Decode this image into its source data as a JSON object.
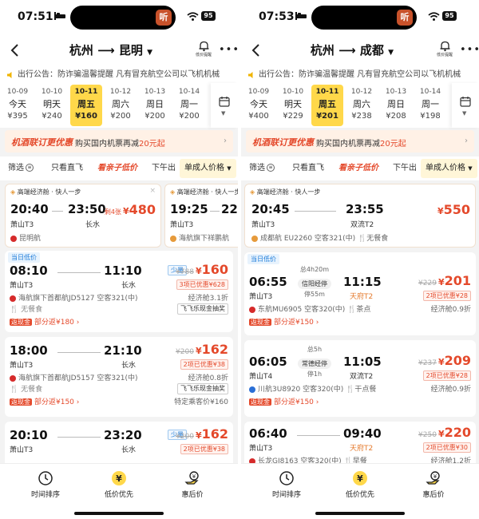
{
  "screens": [
    {
      "status_time": "07:51",
      "battery": "95",
      "from_city": "杭州",
      "to_city": "昆明",
      "bell_label": "低价提醒",
      "notice": "出行公告：防诈骗温馨提醒  凡有冒充航空公司以飞机机械",
      "dates": [
        {
          "date": "10-09",
          "weekday": "今天",
          "price": "¥395"
        },
        {
          "date": "10-10",
          "weekday": "明天",
          "price": "¥240"
        },
        {
          "date": "10-11",
          "weekday": "周五",
          "price": "¥160"
        },
        {
          "date": "10-12",
          "weekday": "周六",
          "price": "¥200"
        },
        {
          "date": "10-13",
          "weekday": "周日",
          "price": "¥200"
        },
        {
          "date": "10-14",
          "weekday": "周一",
          "price": "¥200"
        }
      ],
      "promo": {
        "title": "机酒联订更优惠",
        "text": "购买国内机票再减",
        "amount": "20元起"
      },
      "filters": {
        "f1": "筛选",
        "f2": "只看直飞",
        "f3": "看亲子低价",
        "f4": "下午出",
        "select": "单成人价格"
      },
      "highlight_badge": "高端经济舱 · 快人一步",
      "highlight_flights": [
        {
          "dep_time": "20:40",
          "arr_time": "23:50",
          "dep_ap": "萧山T3",
          "arr_ap": "长水",
          "remain": "剩4张",
          "price": "480",
          "airline": "昆明航"
        },
        {
          "dep_time": "19:25",
          "arr_time": "22:",
          "dep_ap": "萧山T3",
          "airline": "海航旗下祥鹏航"
        }
      ],
      "flights": [
        {
          "badge": "当日低价",
          "dep_time": "08:10",
          "arr_time": "11:10",
          "dep_ap": "萧山T3",
          "arr_ap": "长水",
          "tag": "少量",
          "orig_price": "¥788",
          "price": "160",
          "coupon": "3项已优惠¥628",
          "airline": "海航旗下首都航JD5127  空客321(中)",
          "cabin": "经济舱3.1折",
          "meal": "无餐食",
          "cash_tag": "飞飞乐现金抽奖",
          "rebate_box": "返现金",
          "rebate": "部分返¥180"
        },
        {
          "dep_time": "18:00",
          "arr_time": "21:10",
          "dep_ap": "萧山T3",
          "arr_ap": "长水",
          "orig_price": "¥200",
          "price": "162",
          "coupon": "2项已优惠¥38",
          "airline": "海航旗下首都航JD5157  空客321(中)",
          "cabin": "经济舱0.8折",
          "meal": "无餐食",
          "cash_tag": "飞飞乐现金抽奖",
          "note": "特定乘客价¥160",
          "rebate_box": "返现金",
          "rebate": "部分返¥150"
        },
        {
          "dep_time": "20:10",
          "arr_time": "23:20",
          "dep_ap": "萧山T3",
          "arr_ap": "长水",
          "tag": "少量",
          "orig_price": "¥200",
          "price": "162",
          "coupon": "2项已优惠¥38"
        }
      ],
      "tabs": [
        "时间排序",
        "低价优先",
        "惠后价"
      ]
    },
    {
      "status_time": "07:53",
      "battery": "95",
      "from_city": "杭州",
      "to_city": "成都",
      "bell_label": "低价提醒",
      "notice": "出行公告：防诈骗温馨提醒  凡有冒充航空公司以飞机机械",
      "dates": [
        {
          "date": "10-09",
          "weekday": "今天",
          "price": "¥400"
        },
        {
          "date": "10-10",
          "weekday": "明天",
          "price": "¥229"
        },
        {
          "date": "10-11",
          "weekday": "周五",
          "price": "¥201"
        },
        {
          "date": "10-12",
          "weekday": "周六",
          "price": "¥238"
        },
        {
          "date": "10-13",
          "weekday": "周日",
          "price": "¥208"
        },
        {
          "date": "10-14",
          "weekday": "周一",
          "price": "¥198"
        }
      ],
      "promo": {
        "title": "机酒联订更优惠",
        "text": "购买国内机票再减",
        "amount": "20元起"
      },
      "filters": {
        "f1": "筛选",
        "f2": "只看直飞",
        "f3": "看亲子低价",
        "f4": "下午出",
        "select": "单成人价格"
      },
      "highlight_badge": "高端经济舱 · 快人一步",
      "highlight_flights": [
        {
          "dep_time": "20:45",
          "arr_time": "23:55",
          "dep_ap": "萧山T3",
          "arr_ap": "双流T2",
          "price": "550",
          "airline": "成都航  EU2260",
          "plane": "空客321(中)",
          "meal": "无餐食"
        }
      ],
      "flights": [
        {
          "badge": "当日低价",
          "dep_time": "06:55",
          "arr_time": "11:15",
          "dep_ap": "萧山T3",
          "arr_ap": "天府T2",
          "duration": "总4h20m",
          "via": "信阳经停",
          "stop": "停55m",
          "orig_price": "¥229",
          "price": "201",
          "coupon": "2项已优惠¥28",
          "airline": "东航MU6905  空客320(中)",
          "meal": "茶点",
          "cabin": "经济舱0.9折",
          "rebate_box": "返现金",
          "rebate": "部分返¥150"
        },
        {
          "dep_time": "06:05",
          "arr_time": "11:05",
          "dep_ap": "萧山T4",
          "arr_ap": "双流T2",
          "duration": "总5h",
          "via": "常德经停",
          "stop": "停1h",
          "orig_price": "¥237",
          "price": "209",
          "coupon": "2项已优惠¥28",
          "airline": "川航3U8920  空客320(中)",
          "meal": "干点餐",
          "cabin": "经济舱0.9折",
          "rebate_box": "返现金",
          "rebate": "部分返¥150"
        },
        {
          "dep_time": "06:40",
          "arr_time": "09:40",
          "dep_ap": "萧山T3",
          "arr_ap": "天府T2",
          "orig_price": "¥250",
          "price": "220",
          "coupon": "2项已优惠¥30",
          "airline": "长龙GJ8163  空客320(中)",
          "meal": "早餐",
          "cabin": "经济舱1.2折"
        }
      ],
      "tabs": [
        "时间排序",
        "低价优先",
        "惠后价"
      ]
    }
  ]
}
